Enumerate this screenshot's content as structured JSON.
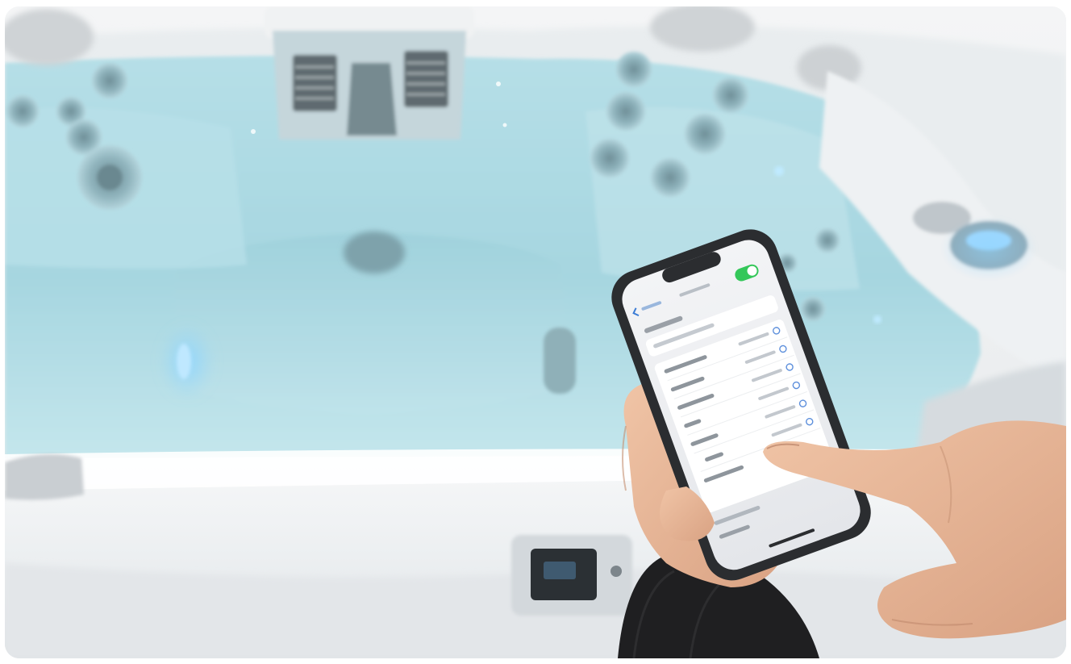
{
  "photo": {
    "subject": "hot-tub-phone-control",
    "colors": {
      "water": "#a9d9e3",
      "water_deep": "#8cc9d6",
      "shell": "#f2f3f4",
      "shell_shadow": "#d8dcdf",
      "jet": "#7fa6b0",
      "phone_case": "#2b2d30",
      "screen": "#eef0f3",
      "toggle_on": "#34c759",
      "skin": "#e8b898",
      "sleeve": "#1f1f21",
      "light_glow": "#6fc8ff"
    }
  },
  "phone_screen": {
    "status_time": "",
    "rows": [
      "",
      "",
      "",
      "",
      "",
      "",
      "",
      ""
    ]
  }
}
